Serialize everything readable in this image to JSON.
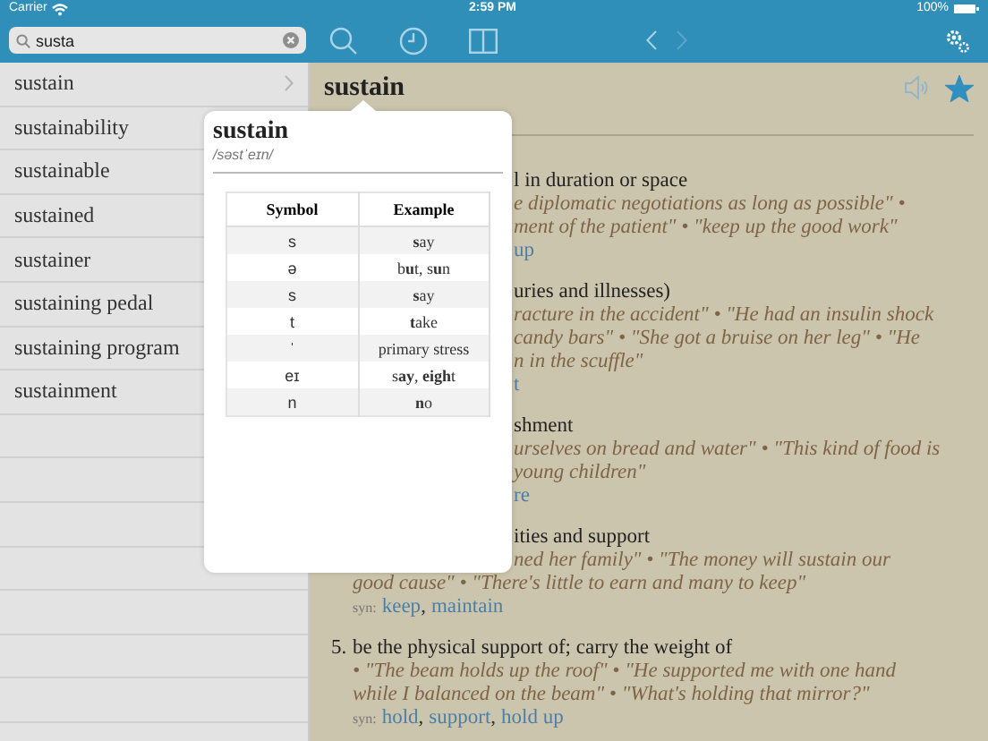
{
  "status_bar": {
    "carrier": "Carrier",
    "time": "2:59 PM",
    "battery": "100%"
  },
  "search": {
    "value": "susta"
  },
  "nav": {
    "back_disabled": false,
    "forward_disabled": true
  },
  "word_list": [
    {
      "text": "sustain",
      "disclosure": true
    },
    {
      "text": "sustainability"
    },
    {
      "text": "sustainable"
    },
    {
      "text": "sustained"
    },
    {
      "text": "sustainer"
    },
    {
      "text": "sustaining pedal"
    },
    {
      "text": "sustaining program"
    },
    {
      "text": "sustainment"
    }
  ],
  "entry": {
    "headword": "sustain",
    "favorite": true,
    "senses": [
      {
        "lines": [
          {
            "kind": "definition",
            "behind_popover": true,
            "text": "l in duration or space"
          },
          {
            "kind": "example",
            "behind_popover": true,
            "text": "e diplomatic negotiations as long as possible\" •"
          },
          {
            "kind": "example",
            "behind_popover": true,
            "text": "ment of the patient\" • \"keep up the good work\""
          },
          {
            "kind": "syn",
            "behind_popover": true,
            "links": [
              "up"
            ]
          }
        ]
      },
      {
        "lines": [
          {
            "kind": "definition",
            "behind_popover": true,
            "text": "uries and illnesses)"
          },
          {
            "kind": "example",
            "behind_popover": true,
            "text": "racture in the accident\" • \"He had an insulin shock"
          },
          {
            "kind": "example",
            "behind_popover": true,
            "text": "candy bars\" • \"She got a bruise on her leg\" • \"He"
          },
          {
            "kind": "example",
            "behind_popover": true,
            "text": "n in the scuffle\""
          },
          {
            "kind": "syn",
            "behind_popover": true,
            "links": [
              "t"
            ]
          }
        ]
      },
      {
        "lines": [
          {
            "kind": "definition",
            "behind_popover": true,
            "text": "shment"
          },
          {
            "kind": "example",
            "behind_popover": true,
            "text": "urselves on bread and water\" • \"This kind of food is"
          },
          {
            "kind": "example",
            "behind_popover": true,
            "text": "young children\""
          },
          {
            "kind": "syn",
            "behind_popover": true,
            "links": [
              "re"
            ]
          }
        ]
      },
      {
        "lines": [
          {
            "kind": "definition",
            "behind_popover": true,
            "text": "ities and support"
          },
          {
            "kind": "example",
            "behind_popover": true,
            "text": "ned her family\" • \"The money will sustain our"
          },
          {
            "kind": "example",
            "text": "good cause\" • \"There's little to earn and many to keep\""
          },
          {
            "kind": "syn",
            "label": "syn:",
            "separator": ",",
            "links": [
              "keep",
              "maintain"
            ]
          }
        ]
      },
      {
        "number": "5.",
        "lines": [
          {
            "kind": "definition",
            "text": "be the physical support of; carry the weight of"
          },
          {
            "kind": "example",
            "text": "• \"The beam holds up the roof\" • \"He supported me with one hand"
          },
          {
            "kind": "example",
            "text": "while I balanced on the beam\" • \"What's holding that mirror?\""
          },
          {
            "kind": "syn",
            "label": "syn:",
            "separator": ",",
            "links": [
              "hold",
              "support",
              "hold up"
            ]
          }
        ]
      }
    ]
  },
  "popover": {
    "word": "sustain",
    "pronunciation": "/səstˈeɪn/",
    "columns": [
      "Symbol",
      "Example"
    ],
    "rows": [
      [
        "s",
        "**s**ay"
      ],
      [
        "ə",
        "b**u**t, s**u**n"
      ],
      [
        "s",
        "**s**ay"
      ],
      [
        "t",
        "**t**ake"
      ],
      [
        "ˈ",
        "primary stress"
      ],
      [
        "eɪ",
        "s**ay**, **eigh**t"
      ],
      [
        "n",
        "**n**o"
      ]
    ]
  }
}
